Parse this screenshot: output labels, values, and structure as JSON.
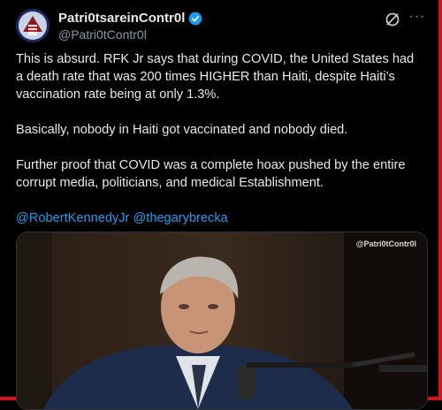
{
  "post": {
    "display_name": "Patri0tsareinContr0l",
    "handle": "@Patri0tContr0l",
    "paragraphs": [
      "This is absurd. RFK Jr says that during COVID, the United States had a death rate that was 200 times HIGHER than Haiti, despite Haiti’s vaccination rate being at only 1.3%.",
      "Basically, nobody in Haiti got vaccinated and nobody died.",
      "Further proof that COVID was a complete hoax pushed by the entire corrupt media, politicians, and medical Establishment."
    ],
    "mentions": [
      "@RobertKennedyJr",
      "@thegarybrecka"
    ],
    "media_watermark": "@Patri0tContr0l"
  },
  "colors": {
    "link": "#1d9bf0",
    "verified": "#1d9bf0",
    "frame": "#d9101f"
  },
  "icons": {
    "verified": "verified-badge-icon",
    "grok": "grok-icon",
    "more": "more-dots-icon"
  }
}
